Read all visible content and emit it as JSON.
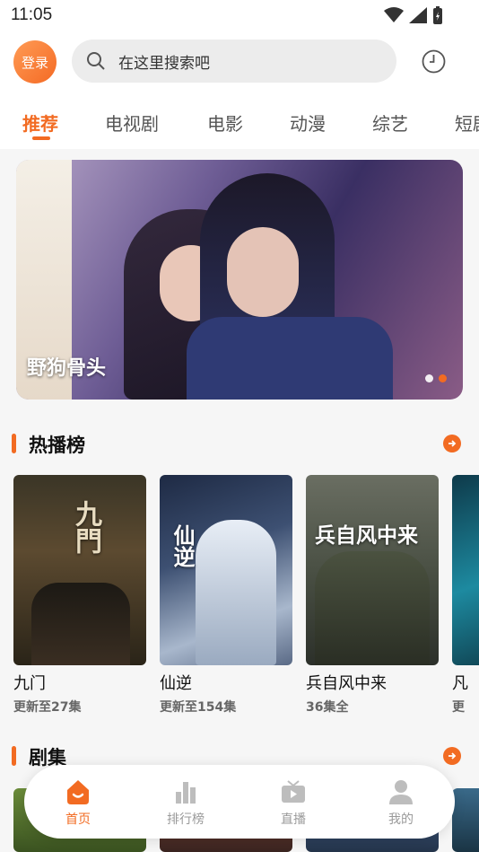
{
  "status_bar": {
    "time": "11:05",
    "icons": [
      "wifi-icon",
      "signal-icon",
      "battery-icon"
    ]
  },
  "header": {
    "login_label": "登录",
    "search_placeholder": "在这里搜索吧",
    "history_icon": "clock-icon"
  },
  "tabs": [
    {
      "label": "推荐",
      "active": true
    },
    {
      "label": "电视剧"
    },
    {
      "label": "电影"
    },
    {
      "label": "动漫"
    },
    {
      "label": "综艺"
    },
    {
      "label": "短剧"
    }
  ],
  "banner": {
    "title": "野狗骨头",
    "slide_count": 2,
    "active_slide": 2
  },
  "hot_section": {
    "title": "热播榜",
    "items": [
      {
        "name": "九门",
        "sub": "更新至27集",
        "poster_text": "九門"
      },
      {
        "name": "仙逆",
        "sub": "更新至154集",
        "poster_text": "仙逆"
      },
      {
        "name": "兵自风中来",
        "sub": "36集全",
        "poster_text": "兵自风中来"
      },
      {
        "name": "凡",
        "sub": "更"
      }
    ]
  },
  "drama_section": {
    "title": "剧集"
  },
  "bottom_nav": [
    {
      "label": "首页",
      "icon": "home-icon",
      "active": true
    },
    {
      "label": "排行榜",
      "icon": "bar-chart-icon"
    },
    {
      "label": "直播",
      "icon": "tv-icon"
    },
    {
      "label": "我的",
      "icon": "user-icon"
    }
  ],
  "colors": {
    "accent": "#f26b22",
    "background": "#f6f6f6"
  }
}
